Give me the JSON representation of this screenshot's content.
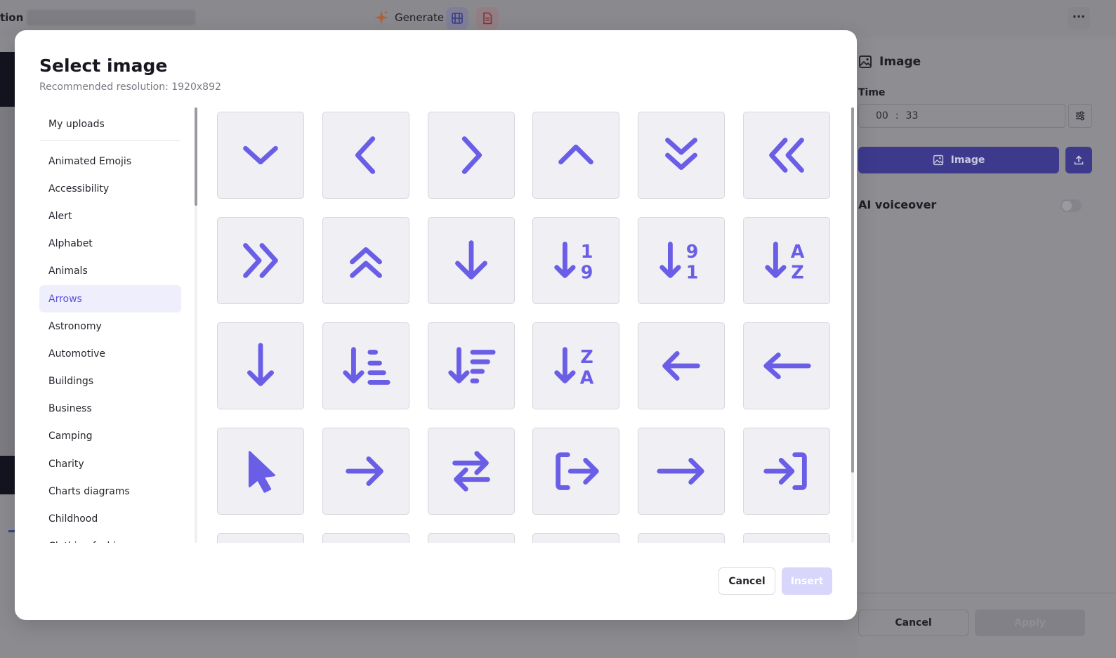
{
  "topbar": {
    "app_name": "tion",
    "generate_label": "Generate",
    "film_icon": "film-icon",
    "doc_icon": "document-icon",
    "more_label": "···"
  },
  "right_panel": {
    "title": "Image",
    "time_label": "Time",
    "time_minutes": "00",
    "time_separator": ":",
    "time_seconds": "33",
    "image_button_label": "Image",
    "ai_voiceover_label": "AI voiceover",
    "cancel_label": "Cancel",
    "apply_label": "Apply"
  },
  "modal": {
    "title": "Select image",
    "subtitle": "Recommended resolution: 1920x892",
    "uploads_label": "My uploads",
    "categories": [
      "Animated Emojis",
      "Accessibility",
      "Alert",
      "Alphabet",
      "Animals",
      "Arrows",
      "Astronomy",
      "Automotive",
      "Buildings",
      "Business",
      "Camping",
      "Charity",
      "Charts diagrams",
      "Childhood",
      "Clothing fashion"
    ],
    "active_category": "Arrows",
    "icons": [
      "chevron-down",
      "chevron-left",
      "chevron-right",
      "chevron-up",
      "chevrons-down",
      "chevrons-left",
      "chevrons-right",
      "chevrons-up",
      "arrow-down",
      "arrow-down-1-9",
      "arrow-down-9-1",
      "arrow-down-a-z",
      "arrow-down-long",
      "arrow-down-short-wide",
      "arrow-down-wide-short",
      "arrow-down-z-a",
      "arrow-left",
      "arrow-left-long",
      "arrow-pointer",
      "arrow-right",
      "arrows-left-right",
      "arrow-right-from-bracket",
      "arrow-right-long",
      "arrow-right-to-bracket",
      "more-1",
      "more-2",
      "more-3",
      "more-4",
      "more-5",
      "more-6"
    ],
    "digits_top": "1",
    "digits_bottom": "9",
    "letter_a": "A",
    "letter_z": "Z",
    "cancel_label": "Cancel",
    "insert_label": "Insert",
    "accent_color": "#6b5ee6"
  }
}
